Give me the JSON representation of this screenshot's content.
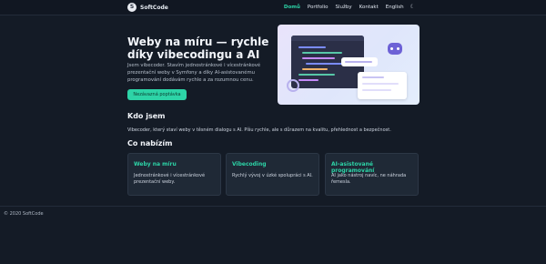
{
  "brand": {
    "logo_text": "S",
    "name": "SoftCode"
  },
  "nav": {
    "items": [
      "Domů",
      "Portfolio",
      "Služby",
      "Kontakt",
      "English"
    ],
    "theme_icon": "moon-icon"
  },
  "hero": {
    "title": "Weby na míru — rychle díky vibecodingu a AI",
    "description": "Jsem vibecoder. Stavím jednostránkové i vícestránkové prezentační weby v Symfony a díky AI-asistovanému programování dodávám rychle a za rozumnou cenu.",
    "cta_label": "Nezávazná poptávka",
    "illustration": "developer-ai-illustration"
  },
  "about": {
    "title": "Kdo jsem",
    "text": "Vibecoder, který staví weby v těsném dialogu s AI. Píšu rychle, ale s důrazem na kvalitu, přehlednost a bezpečnost."
  },
  "offer": {
    "title": "Co nabízím",
    "cards": [
      {
        "title": "Weby na míru",
        "text": "Jednostránkové i vícestránkové prezentační weby."
      },
      {
        "title": "Vibecoding",
        "text": "Rychlý vývoj v úzké spolupráci s AI."
      },
      {
        "title": "AI-asistované programování",
        "text": "AI jako nástroj navíc, ne náhrada řemesla."
      }
    ]
  },
  "footer": {
    "copyright": "© 2020 SoftCode"
  },
  "colors": {
    "accent": "#2dd4a7",
    "background": "#141b26",
    "card": "#1f2936"
  }
}
